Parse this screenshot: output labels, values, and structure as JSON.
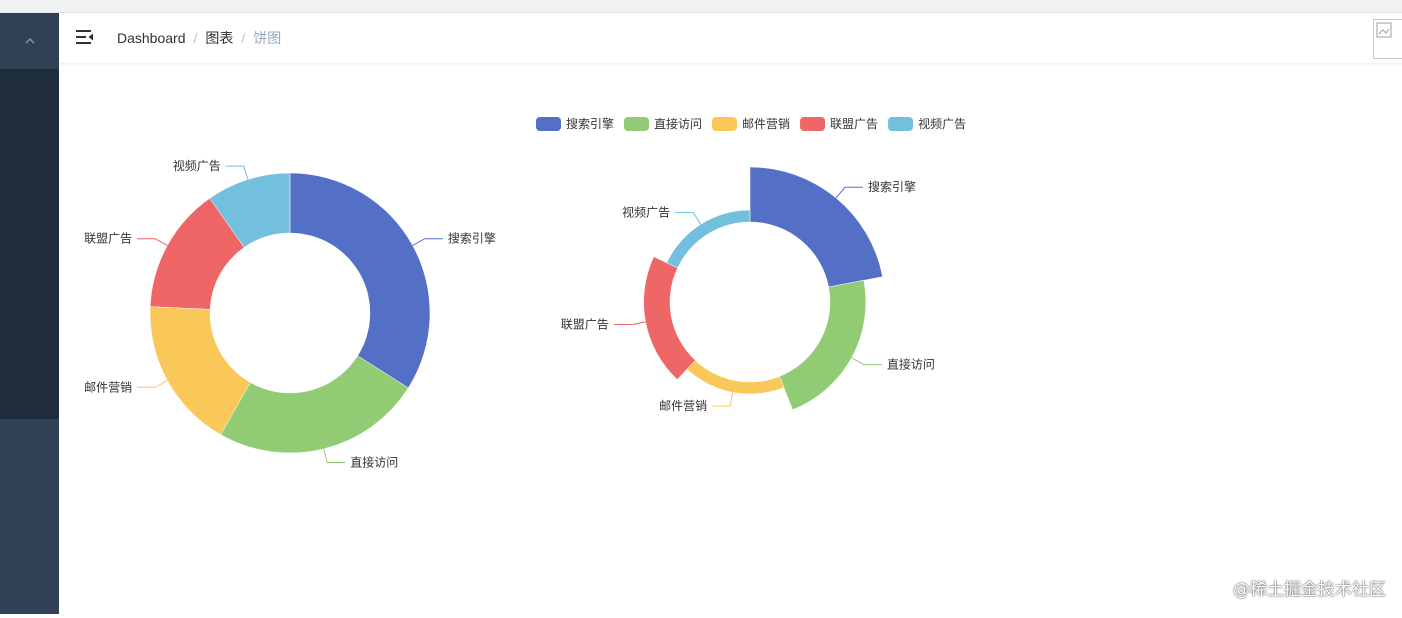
{
  "breadcrumb": {
    "items": [
      "Dashboard",
      "图表",
      "饼图"
    ],
    "separator": "/"
  },
  "icons": {
    "sidebar_toggle": "chevron-up-icon",
    "hamburger": "hamburger-icon",
    "avatar": "broken-image-icon"
  },
  "colors": {
    "sidebar": "#304156",
    "sidebar_active": "#1f2d3d",
    "series": [
      "#5470c6",
      "#91cc75",
      "#fac858",
      "#ee6666",
      "#73c0de"
    ]
  },
  "chart_data": [
    {
      "type": "pie",
      "variant": "donut",
      "legend": [
        "搜索引擎",
        "直接访问",
        "邮件营销",
        "联盟广告",
        "视频广告"
      ],
      "legend_position": "top-center",
      "slices": [
        {
          "name": "搜索引擎",
          "value": 35
        },
        {
          "name": "直接访问",
          "value": 25
        },
        {
          "name": "邮件营销",
          "value": 18
        },
        {
          "name": "联盟广告",
          "value": 15
        },
        {
          "name": "视频广告",
          "value": 10
        }
      ]
    },
    {
      "type": "pie",
      "variant": "rose-radius",
      "slices": [
        {
          "name": "搜索引擎",
          "value": 22,
          "radius_value": 100
        },
        {
          "name": "直接访问",
          "value": 22,
          "radius_value": 80
        },
        {
          "name": "邮件营销",
          "value": 18,
          "radius_value": 55
        },
        {
          "name": "联盟广告",
          "value": 20,
          "radius_value": 70
        },
        {
          "name": "视频广告",
          "value": 18,
          "radius_value": 55
        }
      ]
    }
  ],
  "watermark": "@稀土掘金技术社区"
}
